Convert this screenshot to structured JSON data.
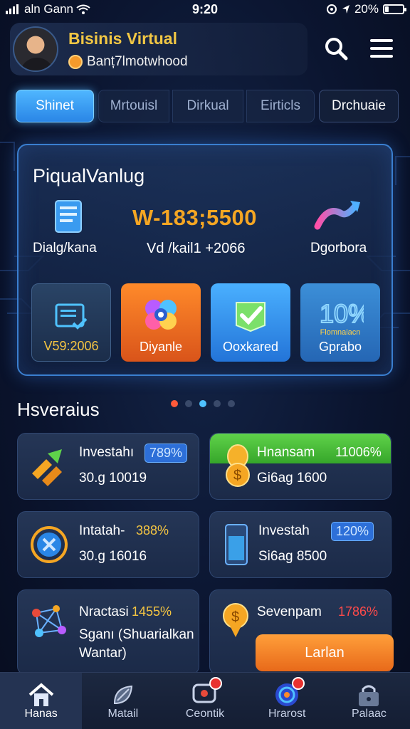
{
  "status_bar": {
    "carrier": "aln Gann",
    "time": "9:20",
    "battery": "20%",
    "battery_level": 0.2
  },
  "header": {
    "title": "Bisinis Virtual",
    "subtitle": "Banț7lmotwhood"
  },
  "tabs": [
    {
      "label": "Shinet",
      "active": true
    },
    {
      "label": "Mrtouisl",
      "active": false
    },
    {
      "label": "Dirkual",
      "active": false
    },
    {
      "label": "Eirticls",
      "active": false
    },
    {
      "label": "Drchuaie",
      "active": false
    }
  ],
  "main_card": {
    "title": "PiqualVanlug",
    "left_label": "Dialg/kana",
    "value": "W-183;5500",
    "value_label": "Vd /kail1 +2066",
    "right_label": "Dgorbora",
    "tiles": [
      {
        "label": "V59:2006",
        "icon": "document-check-icon"
      },
      {
        "label": "Diyanle",
        "icon": "flower-gear-icon"
      },
      {
        "label": "Ooxkared",
        "icon": "checkmark-icon"
      },
      {
        "label": "Gprabo",
        "icon": "percent-chart-icon",
        "caption": "Flomnaiacn"
      }
    ]
  },
  "section": {
    "title": "Hsveraius",
    "dots_count": 5,
    "active_dots": [
      0,
      2
    ]
  },
  "investments": [
    {
      "name": "Investahı",
      "pct": "789%",
      "amount": "30.g 10019",
      "icon": "rocket-arrows-icon"
    },
    {
      "name": "Hnansam",
      "pct": "11006%",
      "amount": "Gi6ag 1600",
      "icon": "coin-bag-icon"
    },
    {
      "name": "Intatah-",
      "pct": "388%",
      "amount": "30.g 16016",
      "icon": "circle-target-icon"
    },
    {
      "name": "Investah",
      "pct": "120%",
      "amount": "Si6ag 8500",
      "icon": "phone-battery-icon"
    },
    {
      "name": "Nractasi",
      "pct": "1455%",
      "amount": "Sganı (Shuarialkan",
      "amount2": "Wantar)",
      "icon": "network-nodes-icon"
    },
    {
      "name": "Sevenpam",
      "pct": "1786%",
      "button": "Larlan",
      "icon": "coin-pin-icon"
    }
  ],
  "bottom_nav": [
    {
      "label": "Hanas",
      "icon": "home-icon",
      "active": true
    },
    {
      "label": "Matail",
      "icon": "leaf-chart-icon",
      "active": false
    },
    {
      "label": "Ceontik",
      "icon": "chat-bubble-icon",
      "active": false
    },
    {
      "label": "Hrarost",
      "icon": "target-orb-icon",
      "active": false
    },
    {
      "label": "Palaac",
      "icon": "lock-bag-icon",
      "active": false
    }
  ],
  "colors": {
    "accent": "#f5a623",
    "title": "#f2c744",
    "tab_active": "#4fb6ff",
    "green": "#5fd24a",
    "orange": "#ff8a2a",
    "badge": "#e8322f"
  }
}
